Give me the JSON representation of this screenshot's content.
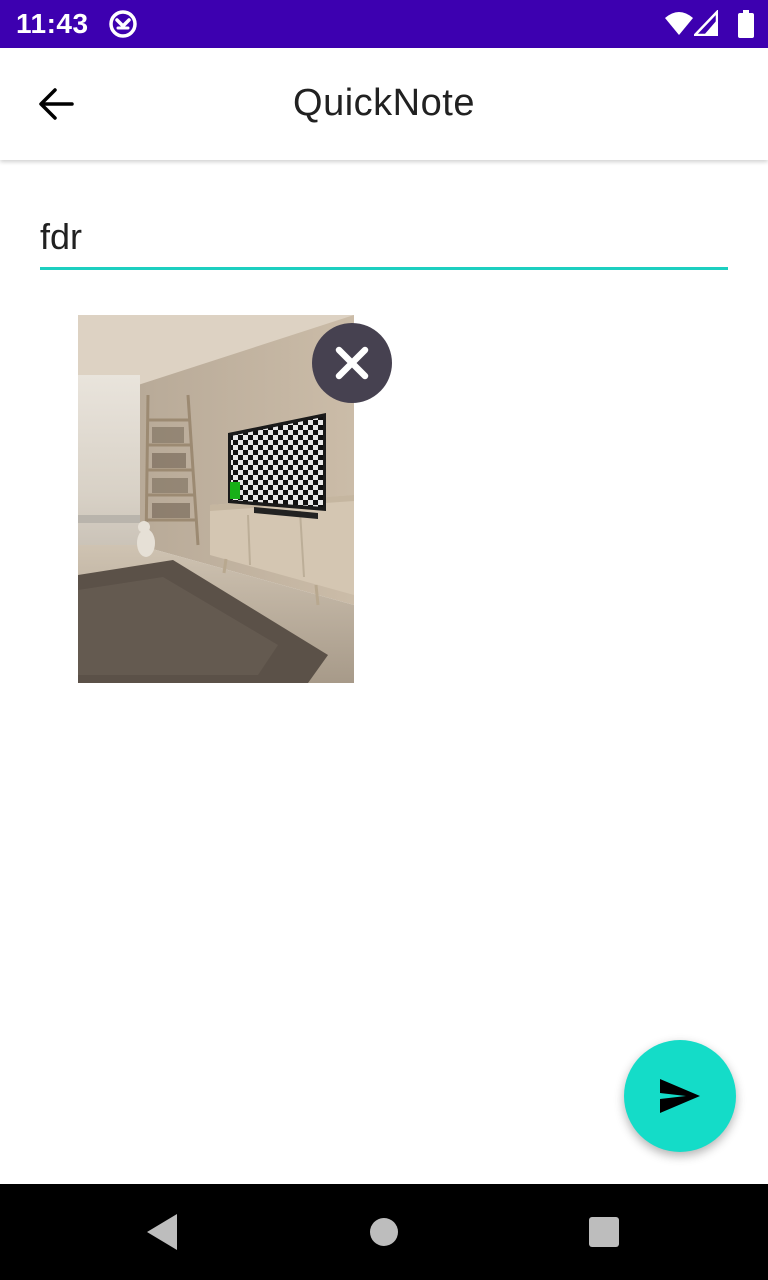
{
  "status_bar": {
    "time": "11:43",
    "background": "#3d00b0",
    "icons": [
      "app-notification-icon",
      "wifi-icon",
      "signal-icon",
      "battery-icon"
    ]
  },
  "app_bar": {
    "title": "QuickNote",
    "back_icon": "arrow-back-icon"
  },
  "note": {
    "text": "fdr",
    "underline_color": "#1ccfc0"
  },
  "attachment": {
    "image_description_icon": "room-photo",
    "remove_icon": "close-icon"
  },
  "fab": {
    "icon": "send-icon",
    "color": "#14dcc8"
  },
  "nav_bar": {
    "buttons": [
      "nav-back-icon",
      "nav-home-icon",
      "nav-recents-icon"
    ]
  }
}
